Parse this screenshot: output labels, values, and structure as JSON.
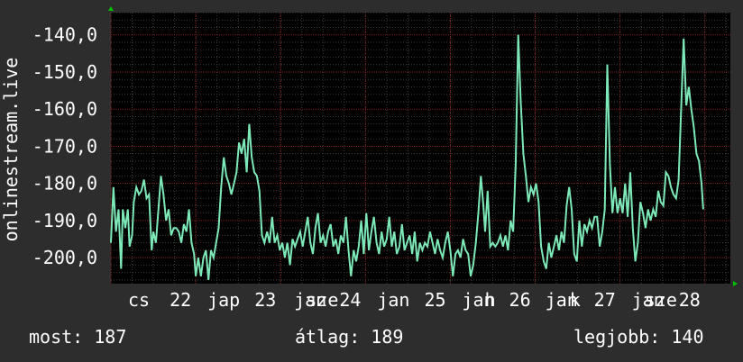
{
  "chart_data": {
    "type": "line",
    "ylabel": "onlinestream.live",
    "ylim": [
      -207,
      -134
    ],
    "y_ticks": [
      -140,
      -150,
      -160,
      -170,
      -180,
      -190,
      -200
    ],
    "y_tick_labels": [
      "-140,0",
      "-150,0",
      "-160,0",
      "-170,0",
      "-180,0",
      "-190,0",
      "-200,0"
    ],
    "x_range": [
      21.0,
      28.3
    ],
    "x_ticks": [
      {
        "x": 21.33,
        "label": "cs"
      },
      {
        "x": 21.82,
        "label": "22"
      },
      {
        "x": 22.33,
        "label": "jap"
      },
      {
        "x": 22.82,
        "label": "23"
      },
      {
        "x": 23.35,
        "label": "jan"
      },
      {
        "x": 23.49,
        "label": "sze"
      },
      {
        "x": 23.82,
        "label": "24"
      },
      {
        "x": 24.33,
        "label": "jan"
      },
      {
        "x": 24.82,
        "label": "25"
      },
      {
        "x": 25.33,
        "label": "jan"
      },
      {
        "x": 25.47,
        "label": "h"
      },
      {
        "x": 25.82,
        "label": "26"
      },
      {
        "x": 26.31,
        "label": "jan"
      },
      {
        "x": 26.47,
        "label": "k"
      },
      {
        "x": 26.82,
        "label": "27"
      },
      {
        "x": 27.33,
        "label": "jan"
      },
      {
        "x": 27.48,
        "label": "sze"
      },
      {
        "x": 27.82,
        "label": "28"
      }
    ],
    "grid": true,
    "series": [
      {
        "color": "#7de9b8",
        "points": [
          [
            21.0,
            -196
          ],
          [
            21.03,
            -181
          ],
          [
            21.06,
            -193
          ],
          [
            21.09,
            -187
          ],
          [
            21.12,
            -203
          ],
          [
            21.14,
            -187
          ],
          [
            21.17,
            -192
          ],
          [
            21.2,
            -187
          ],
          [
            21.22,
            -197
          ],
          [
            21.25,
            -194
          ],
          [
            21.27,
            -185
          ],
          [
            21.3,
            -181
          ],
          [
            21.33,
            -183
          ],
          [
            21.36,
            -182
          ],
          [
            21.39,
            -179
          ],
          [
            21.42,
            -184
          ],
          [
            21.45,
            -183
          ],
          [
            21.48,
            -198
          ],
          [
            21.5,
            -193
          ],
          [
            21.53,
            -196
          ],
          [
            21.56,
            -187
          ],
          [
            21.59,
            -178
          ],
          [
            21.62,
            -183
          ],
          [
            21.65,
            -190
          ],
          [
            21.68,
            -187
          ],
          [
            21.71,
            -194
          ],
          [
            21.74,
            -192
          ],
          [
            21.77,
            -192
          ],
          [
            21.8,
            -193
          ],
          [
            21.83,
            -196
          ],
          [
            21.86,
            -191
          ],
          [
            21.89,
            -193
          ],
          [
            21.92,
            -187
          ],
          [
            21.95,
            -196
          ],
          [
            21.98,
            -199
          ],
          [
            22.0,
            -205
          ],
          [
            22.03,
            -200
          ],
          [
            22.06,
            -205
          ],
          [
            22.09,
            -200
          ],
          [
            22.12,
            -198
          ],
          [
            22.15,
            -206
          ],
          [
            22.18,
            -198
          ],
          [
            22.21,
            -200
          ],
          [
            22.24,
            -196
          ],
          [
            22.27,
            -192
          ],
          [
            22.3,
            -181
          ],
          [
            22.33,
            -173
          ],
          [
            22.36,
            -178
          ],
          [
            22.39,
            -180
          ],
          [
            22.42,
            -183
          ],
          [
            22.45,
            -180
          ],
          [
            22.48,
            -177
          ],
          [
            22.51,
            -169
          ],
          [
            22.54,
            -172
          ],
          [
            22.57,
            -168
          ],
          [
            22.6,
            -177
          ],
          [
            22.63,
            -164
          ],
          [
            22.66,
            -173
          ],
          [
            22.69,
            -177
          ],
          [
            22.72,
            -178
          ],
          [
            22.75,
            -182
          ],
          [
            22.78,
            -194
          ],
          [
            22.81,
            -196
          ],
          [
            22.84,
            -193
          ],
          [
            22.87,
            -196
          ],
          [
            22.9,
            -189
          ],
          [
            22.93,
            -196
          ],
          [
            22.96,
            -194
          ],
          [
            22.99,
            -198
          ],
          [
            23.02,
            -196
          ],
          [
            23.05,
            -200
          ],
          [
            23.08,
            -196
          ],
          [
            23.11,
            -202
          ],
          [
            23.14,
            -195
          ],
          [
            23.17,
            -197
          ],
          [
            23.2,
            -195
          ],
          [
            23.23,
            -193
          ],
          [
            23.26,
            -197
          ],
          [
            23.29,
            -193
          ],
          [
            23.32,
            -189
          ],
          [
            23.35,
            -196
          ],
          [
            23.38,
            -199
          ],
          [
            23.41,
            -192
          ],
          [
            23.44,
            -188
          ],
          [
            23.47,
            -196
          ],
          [
            23.5,
            -194
          ],
          [
            23.53,
            -197
          ],
          [
            23.56,
            -193
          ],
          [
            23.59,
            -191
          ],
          [
            23.62,
            -197
          ],
          [
            23.65,
            -195
          ],
          [
            23.68,
            -199
          ],
          [
            23.71,
            -194
          ],
          [
            23.74,
            -196
          ],
          [
            23.77,
            -189
          ],
          [
            23.8,
            -198
          ],
          [
            23.83,
            -205
          ],
          [
            23.86,
            -198
          ],
          [
            23.89,
            -201
          ],
          [
            23.92,
            -197
          ],
          [
            23.95,
            -190
          ],
          [
            23.98,
            -199
          ],
          [
            24.01,
            -188
          ],
          [
            24.04,
            -198
          ],
          [
            24.07,
            -193
          ],
          [
            24.1,
            -189
          ],
          [
            24.13,
            -196
          ],
          [
            24.16,
            -199
          ],
          [
            24.19,
            -193
          ],
          [
            24.22,
            -197
          ],
          [
            24.25,
            -195
          ],
          [
            24.28,
            -189
          ],
          [
            24.31,
            -197
          ],
          [
            24.34,
            -193
          ],
          [
            24.37,
            -199
          ],
          [
            24.4,
            -197
          ],
          [
            24.43,
            -191
          ],
          [
            24.46,
            -198
          ],
          [
            24.49,
            -196
          ],
          [
            24.52,
            -194
          ],
          [
            24.55,
            -199
          ],
          [
            24.58,
            -193
          ],
          [
            24.61,
            -201
          ],
          [
            24.64,
            -196
          ],
          [
            24.67,
            -198
          ],
          [
            24.7,
            -196
          ],
          [
            24.73,
            -197
          ],
          [
            24.76,
            -193
          ],
          [
            24.79,
            -196
          ],
          [
            24.82,
            -199
          ],
          [
            24.85,
            -195
          ],
          [
            24.88,
            -198
          ],
          [
            24.91,
            -200
          ],
          [
            24.94,
            -196
          ],
          [
            24.97,
            -193
          ],
          [
            25.0,
            -198
          ],
          [
            25.03,
            -205
          ],
          [
            25.06,
            -199
          ],
          [
            25.09,
            -198
          ],
          [
            25.12,
            -200
          ],
          [
            25.15,
            -195
          ],
          [
            25.18,
            -198
          ],
          [
            25.21,
            -199
          ],
          [
            25.24,
            -205
          ],
          [
            25.27,
            -202
          ],
          [
            25.3,
            -196
          ],
          [
            25.33,
            -188
          ],
          [
            25.36,
            -178
          ],
          [
            25.39,
            -186
          ],
          [
            25.41,
            -193
          ],
          [
            25.44,
            -182
          ],
          [
            25.47,
            -197
          ],
          [
            25.5,
            -196
          ],
          [
            25.53,
            -197
          ],
          [
            25.56,
            -196
          ],
          [
            25.59,
            -194
          ],
          [
            25.62,
            -197
          ],
          [
            25.65,
            -194
          ],
          [
            25.68,
            -198
          ],
          [
            25.71,
            -190
          ],
          [
            25.74,
            -193
          ],
          [
            25.77,
            -175
          ],
          [
            25.8,
            -140
          ],
          [
            25.83,
            -158
          ],
          [
            25.86,
            -172
          ],
          [
            25.89,
            -178
          ],
          [
            25.92,
            -185
          ],
          [
            25.95,
            -181
          ],
          [
            25.98,
            -183
          ],
          [
            26.01,
            -180
          ],
          [
            26.04,
            -185
          ],
          [
            26.07,
            -197
          ],
          [
            26.1,
            -201
          ],
          [
            26.13,
            -203
          ],
          [
            26.16,
            -196
          ],
          [
            26.19,
            -200
          ],
          [
            26.22,
            -197
          ],
          [
            26.25,
            -194
          ],
          [
            26.28,
            -198
          ],
          [
            26.31,
            -193
          ],
          [
            26.34,
            -196
          ],
          [
            26.37,
            -186
          ],
          [
            26.4,
            -181
          ],
          [
            26.43,
            -187
          ],
          [
            26.46,
            -199
          ],
          [
            26.49,
            -201
          ],
          [
            26.52,
            -190
          ],
          [
            26.55,
            -197
          ],
          [
            26.58,
            -191
          ],
          [
            26.61,
            -193
          ],
          [
            26.64,
            -190
          ],
          [
            26.67,
            -192
          ],
          [
            26.7,
            -189
          ],
          [
            26.73,
            -189
          ],
          [
            26.76,
            -197
          ],
          [
            26.79,
            -193
          ],
          [
            26.82,
            -187
          ],
          [
            26.85,
            -148
          ],
          [
            26.88,
            -175
          ],
          [
            26.91,
            -188
          ],
          [
            26.94,
            -181
          ],
          [
            26.97,
            -188
          ],
          [
            27.0,
            -184
          ],
          [
            27.03,
            -188
          ],
          [
            27.06,
            -180
          ],
          [
            27.09,
            -189
          ],
          [
            27.12,
            -177
          ],
          [
            27.15,
            -192
          ],
          [
            27.18,
            -201
          ],
          [
            27.21,
            -196
          ],
          [
            27.24,
            -185
          ],
          [
            27.27,
            -188
          ],
          [
            27.3,
            -192
          ],
          [
            27.33,
            -187
          ],
          [
            27.36,
            -190
          ],
          [
            27.39,
            -187
          ],
          [
            27.42,
            -189
          ],
          [
            27.45,
            -182
          ],
          [
            27.48,
            -185
          ],
          [
            27.51,
            -186
          ],
          [
            27.54,
            -177
          ],
          [
            27.57,
            -178
          ],
          [
            27.6,
            -181
          ],
          [
            27.63,
            -183
          ],
          [
            27.66,
            -184
          ],
          [
            27.69,
            -179
          ],
          [
            27.72,
            -160
          ],
          [
            27.75,
            -141
          ],
          [
            27.78,
            -159
          ],
          [
            27.81,
            -154
          ],
          [
            27.84,
            -160
          ],
          [
            27.87,
            -165
          ],
          [
            27.9,
            -172
          ],
          [
            27.93,
            -174
          ],
          [
            27.96,
            -180
          ],
          [
            27.98,
            -187
          ]
        ]
      }
    ]
  },
  "footer": {
    "current": "most: 187",
    "average": "átlag: 189",
    "best": "legjobb: 140"
  },
  "colors": {
    "background": "#2d2d2d",
    "plot_background": "#000000",
    "line": "#7de9b8",
    "grid_major": "#7a1f1f",
    "grid_minor": "#3a3a3a",
    "axis_arrow": "#00c000"
  }
}
